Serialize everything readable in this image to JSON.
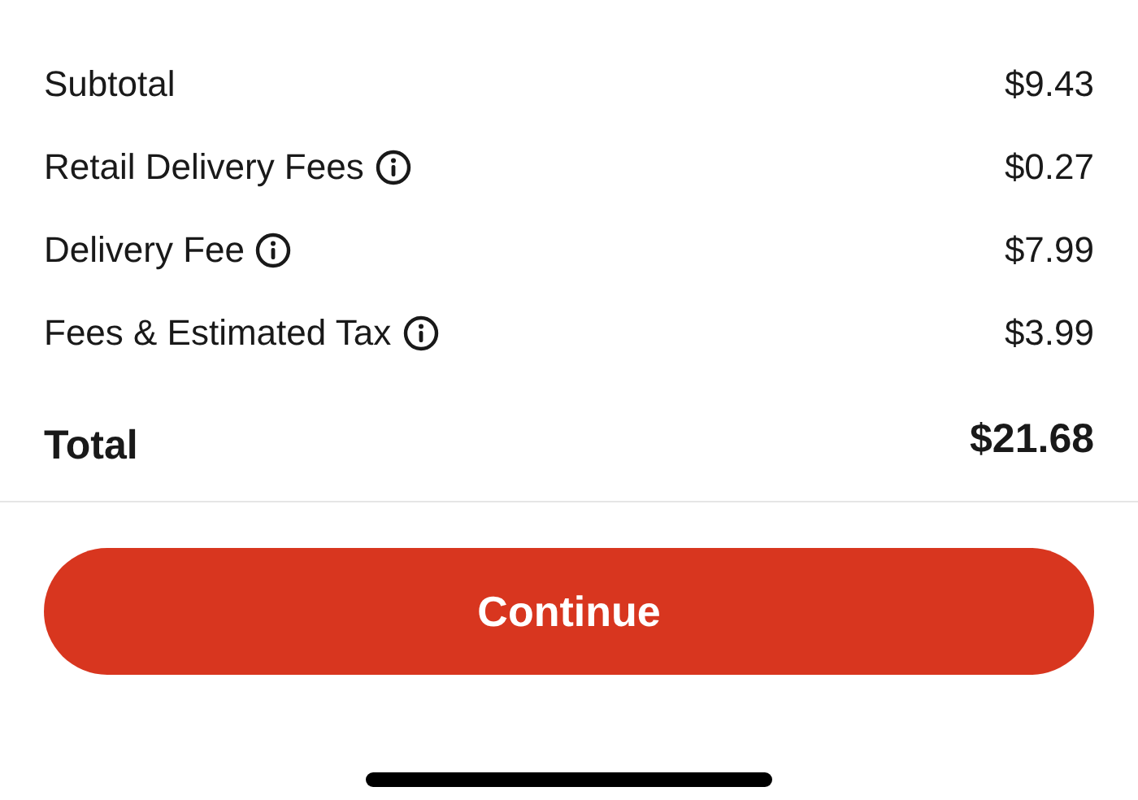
{
  "line_items": [
    {
      "label": "Subtotal",
      "amount": "$9.43",
      "info": false
    },
    {
      "label": "Retail Delivery Fees",
      "amount": "$0.27",
      "info": true
    },
    {
      "label": "Delivery Fee",
      "amount": "$7.99",
      "info": true
    },
    {
      "label": "Fees & Estimated Tax",
      "amount": "$3.99",
      "info": true
    }
  ],
  "total": {
    "label": "Total",
    "amount": "$21.68"
  },
  "continue_button": {
    "label": "Continue"
  }
}
